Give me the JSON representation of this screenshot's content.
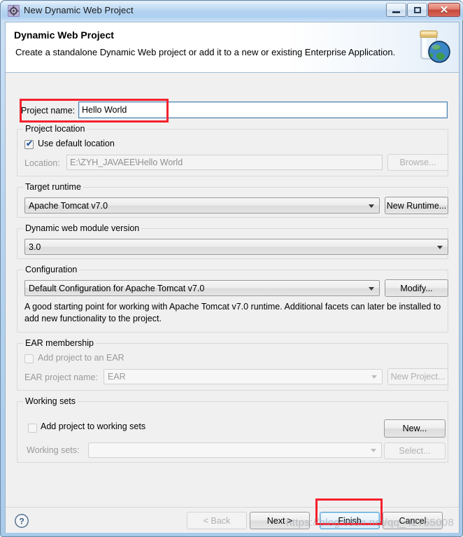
{
  "window": {
    "title": "New Dynamic Web Project",
    "icon": "gear-icon",
    "buttons": {
      "minimize": "minimize-icon",
      "maximize": "maximize-icon",
      "close": "✕"
    }
  },
  "banner": {
    "title": "Dynamic Web Project",
    "description": "Create a standalone Dynamic Web project or add it to a new or existing Enterprise Application.",
    "icon": "jar-globe-icon"
  },
  "project_name": {
    "label": "Project name:",
    "value": "Hello World",
    "placeholder": ""
  },
  "project_location": {
    "group_title": "Project location",
    "use_default_label": "Use default location",
    "use_default_checked": true,
    "location_label": "Location:",
    "location_value": "E:\\ZYH_JAVAEE\\Hello World",
    "browse_label": "Browse..."
  },
  "target_runtime": {
    "group_title": "Target runtime",
    "selected": "Apache Tomcat v7.0",
    "new_runtime_label": "New Runtime..."
  },
  "module_version": {
    "group_title": "Dynamic web module version",
    "selected": "3.0"
  },
  "configuration": {
    "group_title": "Configuration",
    "selected": "Default Configuration for Apache Tomcat v7.0",
    "modify_label": "Modify...",
    "description": "A good starting point for working with Apache Tomcat v7.0 runtime. Additional facets can later be installed to add new functionality to the project."
  },
  "ear_membership": {
    "group_title": "EAR membership",
    "add_to_ear_label": "Add project to an EAR",
    "add_to_ear_checked": false,
    "ear_project_name_label": "EAR project name:",
    "ear_project_name_value": "EAR",
    "new_project_label": "New Project..."
  },
  "working_sets": {
    "group_title": "Working sets",
    "add_to_working_sets_label": "Add project to working sets",
    "add_to_working_sets_checked": false,
    "working_sets_label": "Working sets:",
    "working_sets_value": "",
    "new_label": "New...",
    "select_label": "Select..."
  },
  "footer": {
    "help_icon": "help-question-icon",
    "back_label": "< Back",
    "next_label": "Next >",
    "finish_label": "Finish",
    "cancel_label": "Cancel"
  },
  "watermark": "https://blog.csdn.net/qq_42755008",
  "colors": {
    "annotation_red": "#f5212d",
    "title_gradient_top": "#eaf3fc",
    "title_gradient_bottom": "#c3dcf6",
    "close_button_red": "#c4483a",
    "default_button_blue": "#5ba4d6",
    "dialog_background": "#f0f0f0"
  }
}
